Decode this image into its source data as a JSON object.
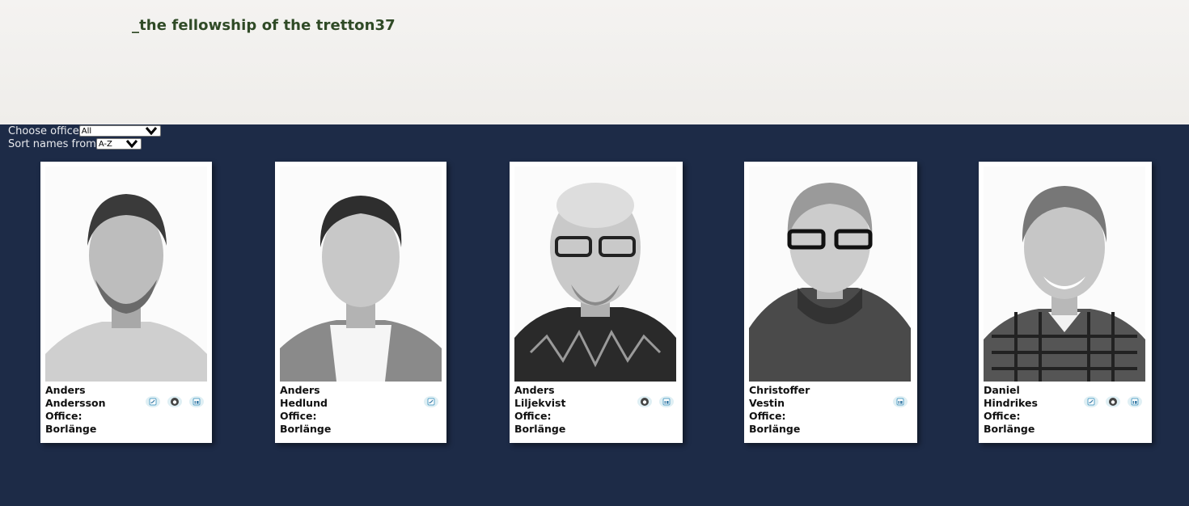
{
  "header": {
    "title": "_the fellowship of the tretton37"
  },
  "filters": {
    "office_label": "Choose office",
    "office_value": "All",
    "sort_label": "Sort names from",
    "sort_value": "A-Z"
  },
  "office_prefix": "Office:",
  "people": [
    {
      "first": "Anders",
      "last": "Andersson",
      "office": "Borlänge",
      "icons": [
        "twitter-icon",
        "github-icon",
        "linkedin-icon"
      ]
    },
    {
      "first": "Anders",
      "last": "Hedlund",
      "office": "Borlänge",
      "icons": [
        "twitter-icon"
      ]
    },
    {
      "first": "Anders",
      "last": "Liljekvist",
      "office": "Borlänge",
      "icons": [
        "github-icon",
        "linkedin-icon"
      ]
    },
    {
      "first": "Christoffer",
      "last": "Vestin",
      "office": "Borlänge",
      "icons": [
        "linkedin-icon"
      ]
    },
    {
      "first": "Daniel",
      "last": "Hindrikes",
      "office": "Borlänge",
      "icons": [
        "twitter-icon",
        "github-icon",
        "linkedin-icon"
      ]
    }
  ]
}
